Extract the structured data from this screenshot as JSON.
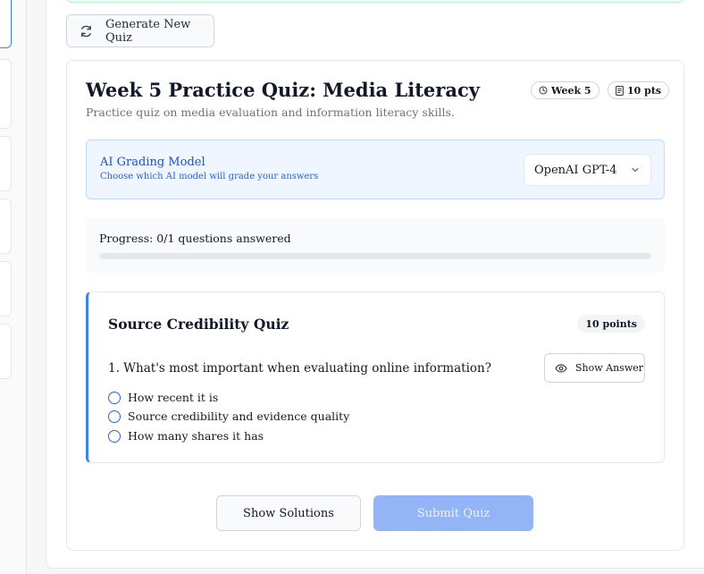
{
  "toolbar": {
    "generate_label": "Generate New Quiz"
  },
  "quiz": {
    "title": "Week 5 Practice Quiz: Media Literacy",
    "subtitle": "Practice quiz on media evaluation and information literacy skills.",
    "week_badge": "Week 5",
    "points_badge": "10 pts"
  },
  "ai_grading": {
    "title": "AI Grading Model",
    "subtitle": "Choose which AI model will grade your answers",
    "selected_model": "OpenAI GPT-4"
  },
  "progress": {
    "label": "Progress: 0/1 questions answered",
    "fraction": 0
  },
  "question_card": {
    "title": "Source Credibility Quiz",
    "points": "10 points",
    "question": "1. What's most important when evaluating online information?",
    "show_answer_label": "Show Answer",
    "options": [
      "How recent it is",
      "Source credibility and evidence quality",
      "How many shares it has"
    ]
  },
  "actions": {
    "show_solutions_label": "Show Solutions",
    "submit_label": "Submit Quiz"
  },
  "colors": {
    "accent": "#3b82f6",
    "submit_disabled": "#93b4f5"
  }
}
